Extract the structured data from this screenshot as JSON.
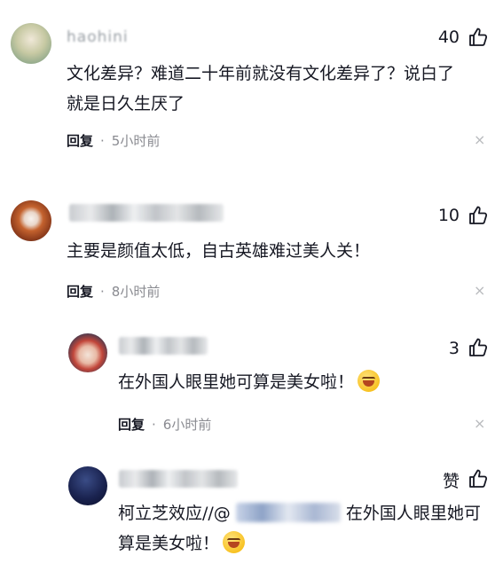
{
  "comments": [
    {
      "name": "haohini",
      "likes": "40",
      "text_lines": [
        "文化差异？难道二十年前就没有文化差异了？说白了",
        "就是日久生厌了"
      ],
      "reply_label": "回复",
      "time": "5小时前",
      "close": "×"
    },
    {
      "likes": "10",
      "text_lines": [
        "主要是颜值太低，自古英雄难过美人关！"
      ],
      "reply_label": "回复",
      "time": "8小时前",
      "close": "×"
    },
    {
      "likes": "3",
      "text": "在外国人眼里她可算是美女啦！",
      "reply_label": "回复",
      "time": "6小时前",
      "close": "×",
      "emoji": "grinning-squint-emoji"
    },
    {
      "likes": "赞",
      "text_line1_a": "柯立芝效应//@",
      "text_line1_b": "在外国人眼里她可",
      "text_line2": "算是美女啦！",
      "emoji": "grinning-squint-emoji"
    }
  ],
  "separator": "·",
  "icons": {
    "like": "thumbs-up-icon",
    "close": "close-icon"
  }
}
